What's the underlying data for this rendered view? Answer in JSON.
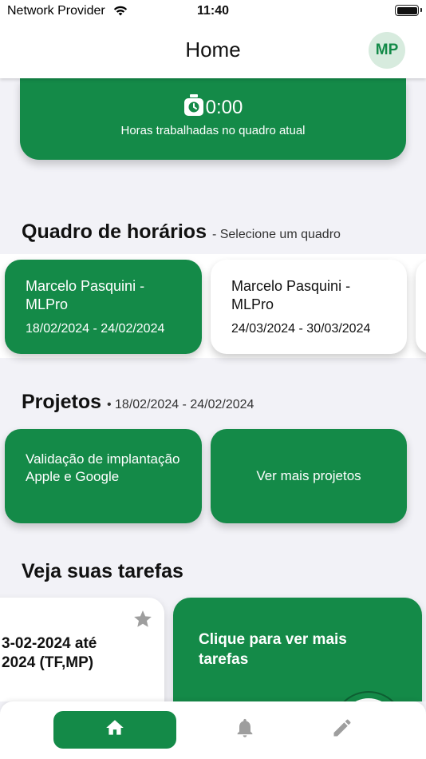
{
  "status_bar": {
    "carrier": "Network Provider",
    "time": "11:40"
  },
  "header": {
    "title": "Home",
    "avatar_initials": "MP"
  },
  "hours_card": {
    "timer": "0:00",
    "caption": "Horas trabalhadas no quadro atual",
    "icon": "stopwatch-icon"
  },
  "schedule": {
    "title": "Quadro de horários",
    "subtitle": "- Selecione um quadro",
    "cards": [
      {
        "name": "Marcelo Pasquini - MLPro",
        "dates": "18/02/2024 - 24/02/2024",
        "selected": true
      },
      {
        "name": "Marcelo Pasquini - MLPro",
        "dates": "24/03/2024 - 30/03/2024",
        "selected": false
      }
    ]
  },
  "projects": {
    "title": "Projetos",
    "subtitle": "• 18/02/2024 - 24/02/2024",
    "items": [
      {
        "label": "Validação de implantação Apple e Google"
      },
      {
        "label": "Ver mais projetos"
      }
    ]
  },
  "tasks": {
    "title": "Veja suas tarefas",
    "card_title": "3-02-2024 até\n2024 (TF,MP)",
    "more_label": "Clique para ver mais tarefas"
  },
  "bottom_nav": {
    "items": [
      "home-icon",
      "bell-icon",
      "pencil-icon"
    ]
  },
  "colors": {
    "primary": "#148a48",
    "background": "#f2f2f7",
    "avatar_bg": "#d7ebde"
  }
}
